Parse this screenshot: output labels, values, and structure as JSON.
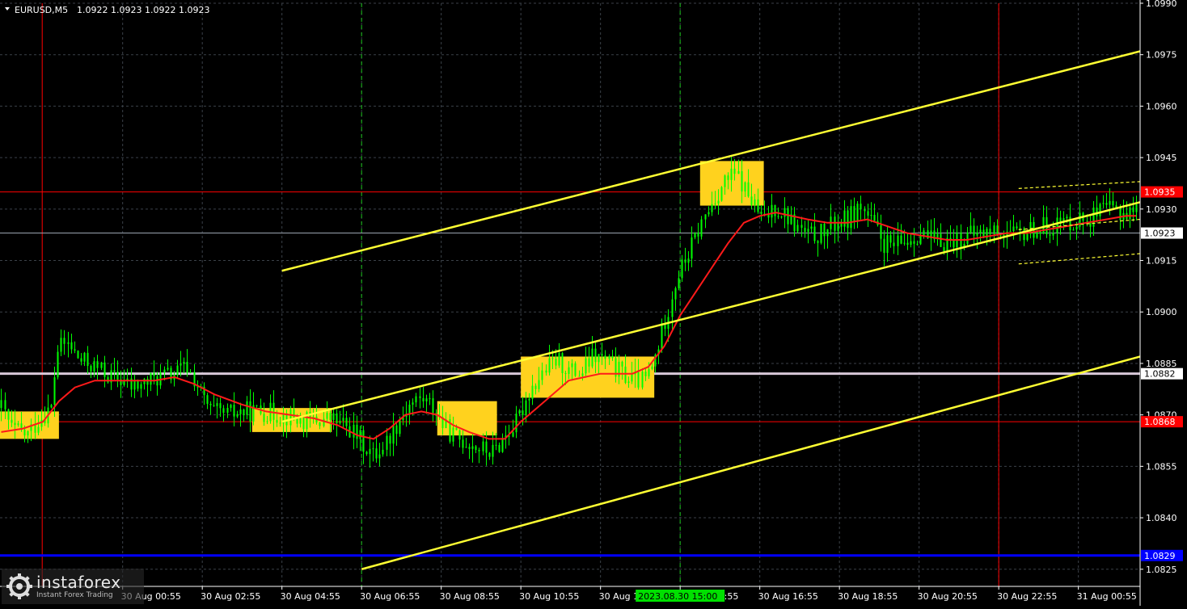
{
  "header": {
    "symbol": "EURUSD,M5",
    "ohlc": "1.0922 1.0923 1.0922 1.0923"
  },
  "watermark": {
    "brand": "instaforex",
    "tagline": "Instant Forex Trading"
  },
  "chart_data": {
    "type": "candlestick",
    "instrument": "EURUSD",
    "timeframe": "M5",
    "grid": true,
    "ylim": [
      1.082,
      1.099
    ],
    "y_ticks": [
      "1.0990",
      "1.0975",
      "1.0960",
      "1.0945",
      "1.0930",
      "1.0915",
      "1.0900",
      "1.0885",
      "1.0870",
      "1.0855",
      "1.0840",
      "1.0825"
    ],
    "x_ticks": [
      {
        "label": "30 Aug 00:55",
        "t": 1.0
      },
      {
        "label": "30 Aug 02:55",
        "t": 3.0
      },
      {
        "label": "30 Aug 04:55",
        "t": 5.0
      },
      {
        "label": "30 Aug 06:55",
        "t": 7.0
      },
      {
        "label": "30 Aug 08:55",
        "t": 9.0
      },
      {
        "label": "30 Aug 10:55",
        "t": 11.0
      },
      {
        "label": "30 Aug 12:55",
        "t": 13.0
      },
      {
        "label": "30 Aug 14:55",
        "t": 15.0
      },
      {
        "label": "30 Aug 16:55",
        "t": 17.0
      },
      {
        "label": "30 Aug 18:55",
        "t": 19.0
      },
      {
        "label": "30 Aug 20:55",
        "t": 21.0
      },
      {
        "label": "30 Aug 22:55",
        "t": 23.0
      },
      {
        "label": "31 Aug 00:55",
        "t": 25.0
      }
    ],
    "x_hour_range": [
      -2.08,
      26.55
    ],
    "time_marker": {
      "label": "2023.08.30 15:00",
      "t": 15.0
    },
    "price_path": [
      [
        -2.05,
        1.0872
      ],
      [
        -1.8,
        1.0866
      ],
      [
        -1.4,
        1.0864
      ],
      [
        -1.1,
        1.0869
      ],
      [
        -0.8,
        1.0872
      ],
      [
        -0.65,
        1.0889
      ],
      [
        -0.4,
        1.0891
      ],
      [
        -0.1,
        1.0886
      ],
      [
        0.3,
        1.0884
      ],
      [
        0.7,
        1.0881
      ],
      [
        1.0,
        1.088
      ],
      [
        1.2,
        1.0878
      ],
      [
        1.5,
        1.0879
      ],
      [
        1.9,
        1.0881
      ],
      [
        2.3,
        1.0882
      ],
      [
        2.6,
        1.0884
      ],
      [
        2.8,
        1.088
      ],
      [
        3.0,
        1.0875
      ],
      [
        3.2,
        1.0871
      ],
      [
        3.6,
        1.087
      ],
      [
        4.0,
        1.0871
      ],
      [
        4.5,
        1.0871
      ],
      [
        5.0,
        1.087
      ],
      [
        5.6,
        1.0868
      ],
      [
        6.2,
        1.0869
      ],
      [
        6.7,
        1.0866
      ],
      [
        7.0,
        1.0862
      ],
      [
        7.3,
        1.0858
      ],
      [
        7.6,
        1.0862
      ],
      [
        7.9,
        1.0868
      ],
      [
        8.2,
        1.0873
      ],
      [
        8.5,
        1.0875
      ],
      [
        8.8,
        1.0872
      ],
      [
        9.1,
        1.0866
      ],
      [
        9.4,
        1.0863
      ],
      [
        9.7,
        1.0862
      ],
      [
        10.0,
        1.086
      ],
      [
        10.3,
        1.0859
      ],
      [
        10.6,
        1.0864
      ],
      [
        10.9,
        1.0868
      ],
      [
        11.2,
        1.0877
      ],
      [
        11.6,
        1.0883
      ],
      [
        11.9,
        1.0886
      ],
      [
        12.2,
        1.0883
      ],
      [
        12.5,
        1.0882
      ],
      [
        12.8,
        1.0887
      ],
      [
        13.1,
        1.0886
      ],
      [
        13.4,
        1.0883
      ],
      [
        13.8,
        1.088
      ],
      [
        14.1,
        1.088
      ],
      [
        14.3,
        1.0884
      ],
      [
        14.6,
        1.0897
      ],
      [
        14.9,
        1.091
      ],
      [
        15.2,
        1.0917
      ],
      [
        15.5,
        1.0925
      ],
      [
        15.8,
        1.0932
      ],
      [
        16.1,
        1.0938
      ],
      [
        16.4,
        1.094
      ],
      [
        16.7,
        1.0934
      ],
      [
        16.9,
        1.093
      ],
      [
        17.1,
        1.0926
      ],
      [
        17.3,
        1.0931
      ],
      [
        17.6,
        1.0929
      ],
      [
        17.9,
        1.0925
      ],
      [
        18.2,
        1.0922
      ],
      [
        18.6,
        1.0923
      ],
      [
        18.9,
        1.0926
      ],
      [
        19.2,
        1.0927
      ],
      [
        19.5,
        1.0931
      ],
      [
        19.8,
        1.0926
      ],
      [
        20.1,
        1.092
      ],
      [
        20.4,
        1.0919
      ],
      [
        20.7,
        1.0921
      ],
      [
        21.0,
        1.0923
      ],
      [
        21.4,
        1.092
      ],
      [
        21.8,
        1.0921
      ],
      [
        22.2,
        1.0922
      ],
      [
        22.6,
        1.0923
      ],
      [
        23.0,
        1.0924
      ],
      [
        23.4,
        1.0922
      ],
      [
        23.8,
        1.0924
      ],
      [
        24.2,
        1.0925
      ],
      [
        24.6,
        1.0926
      ],
      [
        25.0,
        1.0927
      ],
      [
        25.4,
        1.0928
      ],
      [
        25.8,
        1.093
      ],
      [
        26.2,
        1.0929
      ],
      [
        26.45,
        1.093
      ]
    ],
    "moving_average": [
      [
        -2.05,
        1.0865
      ],
      [
        -1.5,
        1.0866
      ],
      [
        -1.0,
        1.0868
      ],
      [
        -0.6,
        1.0874
      ],
      [
        -0.2,
        1.0878
      ],
      [
        0.3,
        1.088
      ],
      [
        0.8,
        1.088
      ],
      [
        1.3,
        1.088
      ],
      [
        1.8,
        1.088
      ],
      [
        2.3,
        1.0881
      ],
      [
        2.8,
        1.0879
      ],
      [
        3.3,
        1.0876
      ],
      [
        4.0,
        1.0873
      ],
      [
        4.6,
        1.0871
      ],
      [
        5.2,
        1.087
      ],
      [
        5.8,
        1.0869
      ],
      [
        6.4,
        1.0867
      ],
      [
        6.9,
        1.0864
      ],
      [
        7.3,
        1.0863
      ],
      [
        7.7,
        1.0866
      ],
      [
        8.1,
        1.087
      ],
      [
        8.5,
        1.0871
      ],
      [
        8.9,
        1.087
      ],
      [
        9.3,
        1.0867
      ],
      [
        9.7,
        1.0865
      ],
      [
        10.2,
        1.0863
      ],
      [
        10.6,
        1.0863
      ],
      [
        11.0,
        1.0868
      ],
      [
        11.4,
        1.0872
      ],
      [
        11.8,
        1.0876
      ],
      [
        12.2,
        1.088
      ],
      [
        12.6,
        1.0881
      ],
      [
        13.0,
        1.0882
      ],
      [
        13.4,
        1.0882
      ],
      [
        13.8,
        1.0882
      ],
      [
        14.2,
        1.0884
      ],
      [
        14.6,
        1.089
      ],
      [
        15.0,
        1.0899
      ],
      [
        15.4,
        1.0906
      ],
      [
        15.8,
        1.0913
      ],
      [
        16.2,
        1.092
      ],
      [
        16.6,
        1.0926
      ],
      [
        17.0,
        1.0928
      ],
      [
        17.4,
        1.0929
      ],
      [
        17.8,
        1.0928
      ],
      [
        18.2,
        1.0927
      ],
      [
        18.7,
        1.0926
      ],
      [
        19.2,
        1.0926
      ],
      [
        19.7,
        1.0927
      ],
      [
        20.2,
        1.0925
      ],
      [
        20.7,
        1.0923
      ],
      [
        21.2,
        1.0922
      ],
      [
        21.7,
        1.0921
      ],
      [
        22.2,
        1.0921
      ],
      [
        22.7,
        1.0922
      ],
      [
        23.2,
        1.0923
      ],
      [
        23.7,
        1.0923
      ],
      [
        24.2,
        1.0924
      ],
      [
        24.7,
        1.0925
      ],
      [
        25.2,
        1.0926
      ],
      [
        25.7,
        1.0927
      ],
      [
        26.2,
        1.0928
      ],
      [
        26.45,
        1.0928
      ]
    ],
    "channel_lines": [
      {
        "t1": 7.0,
        "p1": 1.0825,
        "t2": 26.55,
        "p2": 1.0887
      },
      {
        "t1": 5.0,
        "p1": 1.0868,
        "t2": 26.55,
        "p2": 1.0932
      },
      {
        "t1": 5.0,
        "p1": 1.0912,
        "t2": 26.55,
        "p2": 1.0976
      }
    ],
    "dashed_channel": [
      {
        "t1": 23.5,
        "p1": 1.0936,
        "t2": 26.55,
        "p2": 1.0938
      },
      {
        "t1": 23.5,
        "p1": 1.0924,
        "t2": 26.55,
        "p2": 1.0927
      },
      {
        "t1": 23.5,
        "p1": 1.0914,
        "t2": 26.55,
        "p2": 1.0917
      }
    ],
    "zones": [
      {
        "t1": -2.08,
        "t2": -0.6,
        "p1": 1.0863,
        "p2": 1.0871
      },
      {
        "t1": 4.25,
        "t2": 6.25,
        "p1": 1.0865,
        "p2": 1.0872
      },
      {
        "t1": 8.9,
        "t2": 10.4,
        "p1": 1.0864,
        "p2": 1.0874
      },
      {
        "t1": 11.0,
        "t2": 14.35,
        "p1": 1.0875,
        "p2": 1.0887
      },
      {
        "t1": 15.5,
        "t2": 17.1,
        "p1": 1.0931,
        "p2": 1.0944
      }
    ],
    "levels": [
      {
        "price": 1.0935,
        "label": "1.0935",
        "color": "#ff0000",
        "weight": 1,
        "label_bg": "#ff0000"
      },
      {
        "price": 1.0923,
        "label": "1.0923",
        "color": "#9aa4b0",
        "weight": 1,
        "label_bg": "#ffffff"
      },
      {
        "price": 1.0882,
        "label": "1.0882",
        "color": "#d8c8d8",
        "weight": 3,
        "label_bg": "#ffffff"
      },
      {
        "price": 1.0868,
        "label": "1.0868",
        "color": "#ff0000",
        "weight": 1,
        "label_bg": "#ff0000"
      },
      {
        "price": 1.0829,
        "label": "1.0829",
        "color": "#0000ff",
        "weight": 3,
        "label_bg": "#0000ff"
      }
    ],
    "vertical_lines": [
      {
        "t": -1.02,
        "color": "#ff0000",
        "style": "solid"
      },
      {
        "t": 23.0,
        "color": "#ff0000",
        "style": "solid"
      },
      {
        "t": 7.0,
        "color": "#19c219",
        "style": "dashed"
      },
      {
        "t": 15.0,
        "color": "#19c219",
        "style": "dashed"
      }
    ],
    "colors": {
      "background": "#000000",
      "grid": "#3b4149",
      "candle": "#00ff00",
      "moving_average": "#ff1a1a",
      "channel": "#ffff33",
      "zone": "#ffd21e",
      "axis": "#ffffff",
      "time_marker_bg": "#00e000"
    }
  }
}
